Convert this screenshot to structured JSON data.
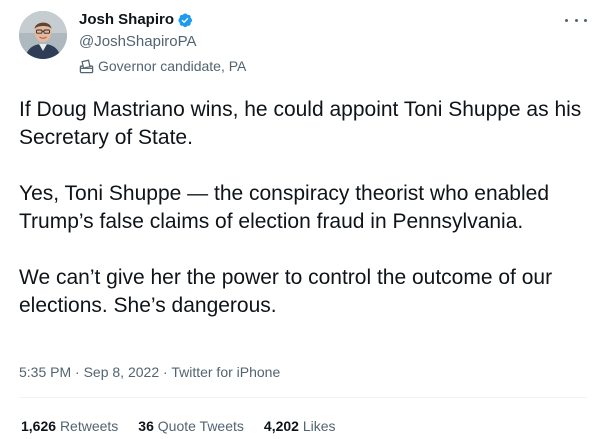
{
  "author": {
    "name": "Josh Shapiro",
    "handle": "@JoshShapiroPA",
    "label": "Governor candidate, PA",
    "verified_color": "#1d9bf0"
  },
  "icons": {
    "verified": "verified-badge-icon",
    "label": "ballot-box-icon",
    "more": "more-options-icon"
  },
  "tweet": {
    "paragraphs": [
      "If Doug Mastriano wins, he could appoint Toni Shuppe as his Secretary of State.",
      "Yes, Toni Shuppe — the conspiracy theorist who enabled Trump’s false claims of election fraud in Pennsylvania.",
      "We can’t give her the power to control the outcome of our elections. She’s dangerous."
    ]
  },
  "meta": {
    "time": "5:35 PM",
    "separator": "·",
    "date": "Sep 8, 2022",
    "source": "Twitter for iPhone"
  },
  "stats": {
    "retweets_count": "1,626",
    "retweets_label": "Retweets",
    "quotes_count": "36",
    "quotes_label": "Quote Tweets",
    "likes_count": "4,202",
    "likes_label": "Likes"
  }
}
